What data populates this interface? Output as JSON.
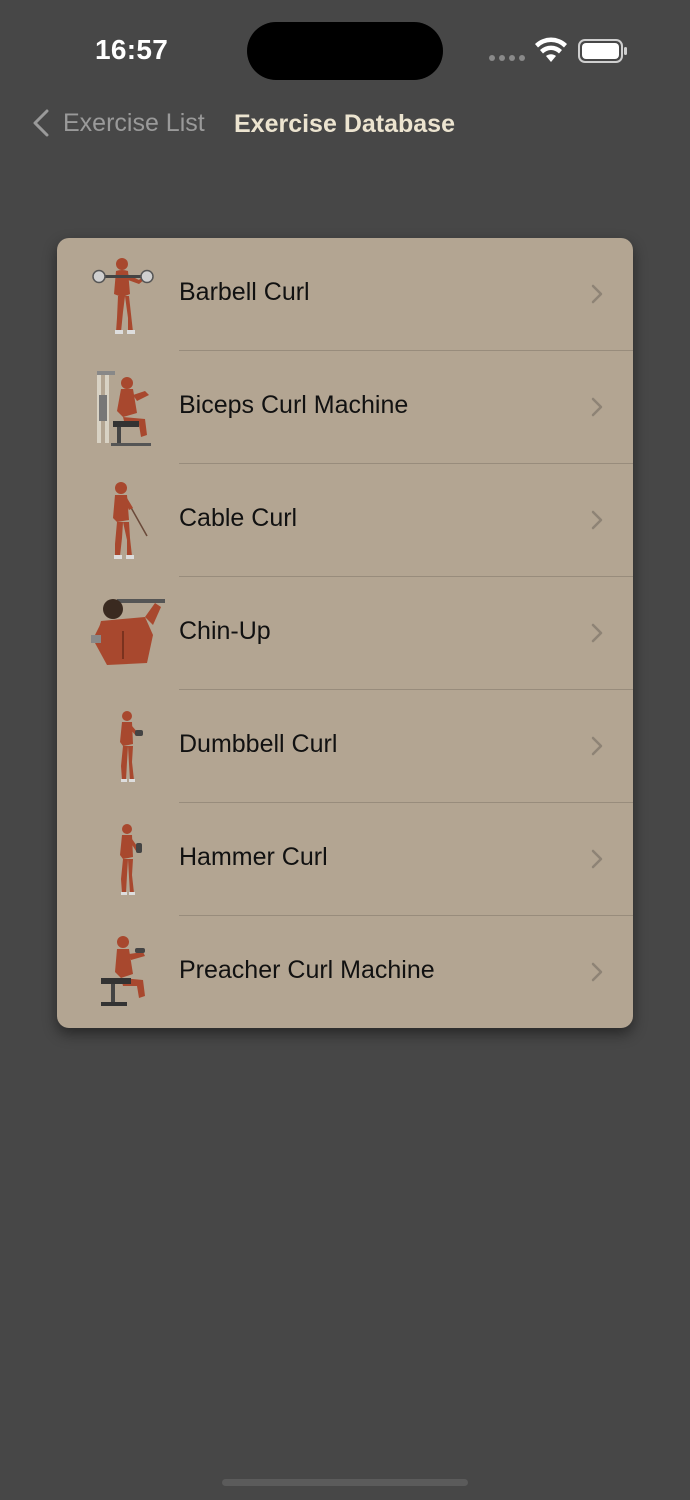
{
  "status_bar": {
    "time": "16:57"
  },
  "nav": {
    "back_label": "Exercise List",
    "title": "Exercise Database"
  },
  "exercises": [
    {
      "label": "Barbell Curl",
      "icon": "barbell-curl-figure"
    },
    {
      "label": "Biceps Curl Machine",
      "icon": "machine-curl-figure"
    },
    {
      "label": "Cable Curl",
      "icon": "cable-curl-figure"
    },
    {
      "label": "Chin-Up",
      "icon": "chin-up-figure"
    },
    {
      "label": "Dumbbell Curl",
      "icon": "dumbbell-curl-figure"
    },
    {
      "label": "Hammer Curl",
      "icon": "hammer-curl-figure"
    },
    {
      "label": "Preacher Curl Machine",
      "icon": "preacher-curl-figure"
    }
  ],
  "colors": {
    "background": "#474747",
    "card": "#b3a592",
    "title": "#ece4d0",
    "muscle": "#a8482e"
  }
}
